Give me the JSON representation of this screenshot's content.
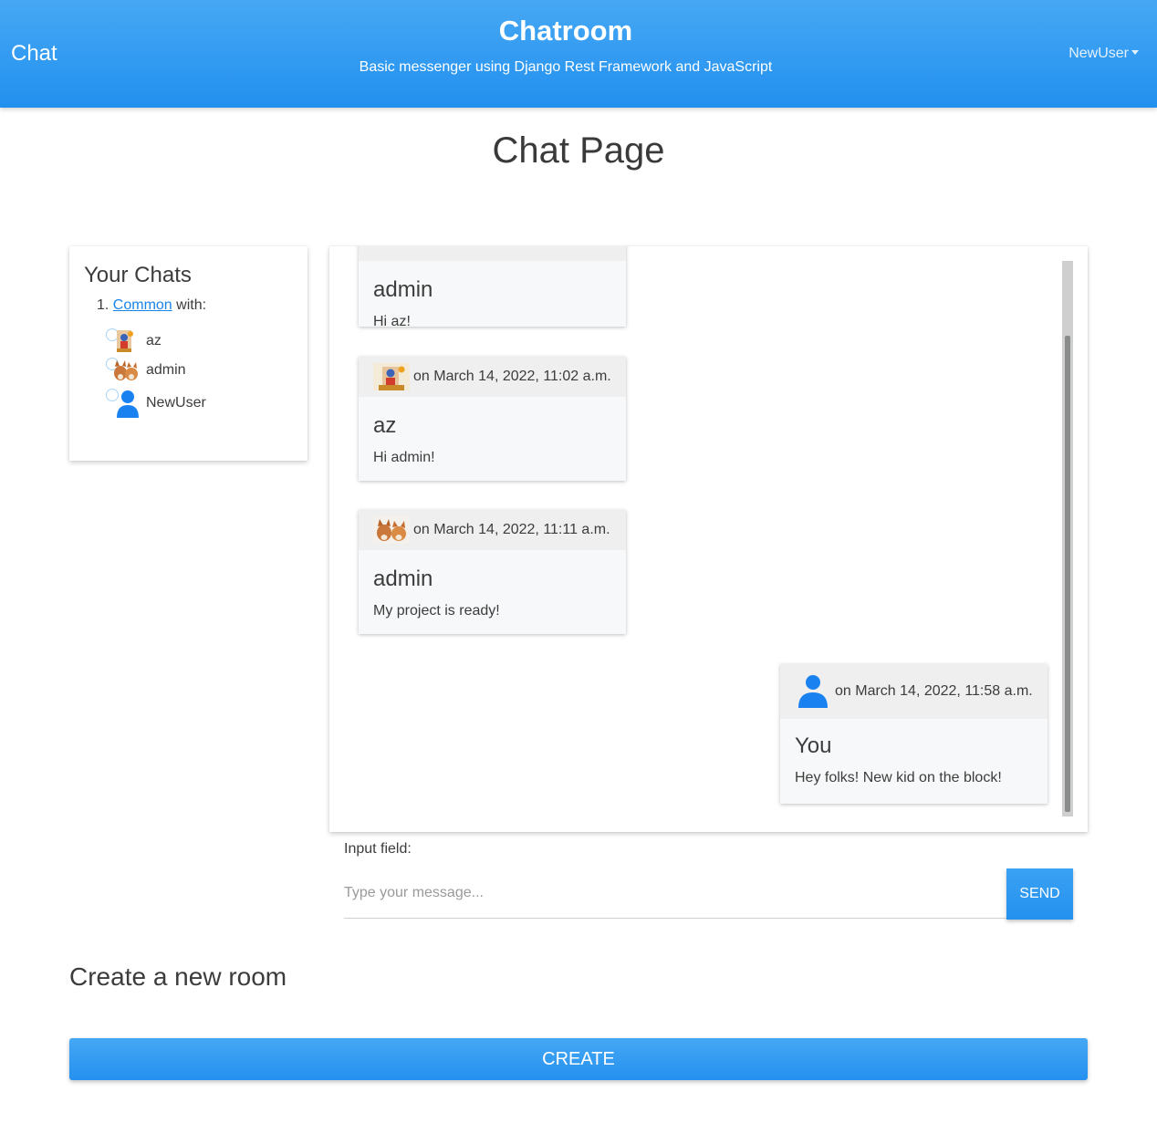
{
  "navbar": {
    "brand": "Chat",
    "title": "Chatroom",
    "subtitle": "Basic messenger using Django Rest Framework and JavaScript",
    "user": "NewUser"
  },
  "page": {
    "heading": "Chat Page"
  },
  "sidebar": {
    "title": "Your Chats",
    "room": {
      "number": "1.",
      "link": "Common",
      "suffix": "with:"
    },
    "members": [
      {
        "name": "az",
        "avatar": "deity-painting-avatar"
      },
      {
        "name": "admin",
        "avatar": "fox-cubs-avatar"
      },
      {
        "name": "NewUser",
        "avatar": "default-person-avatar"
      }
    ]
  },
  "messages": [
    {
      "author": "admin",
      "text": "Hi az!",
      "timestamp": ""
    },
    {
      "author": "az",
      "text": "Hi admin!",
      "timestamp": "on March 14, 2022, 11:02 a.m."
    },
    {
      "author": "admin",
      "text": "My project is ready!",
      "timestamp": "on March 14, 2022, 11:11 a.m."
    },
    {
      "author": "You",
      "text": "Hey folks! New kid on the block!",
      "timestamp": "on March 14, 2022, 11:58 a.m."
    }
  ],
  "composer": {
    "label": "Input field:",
    "placeholder": "Type your message...",
    "send_label": "SEND"
  },
  "create": {
    "heading": "Create a new room",
    "button_label": "CREATE"
  },
  "colors": {
    "primary": "#2196f3",
    "link": "#1a84e8",
    "avatar_blue": "#1a82f0"
  }
}
